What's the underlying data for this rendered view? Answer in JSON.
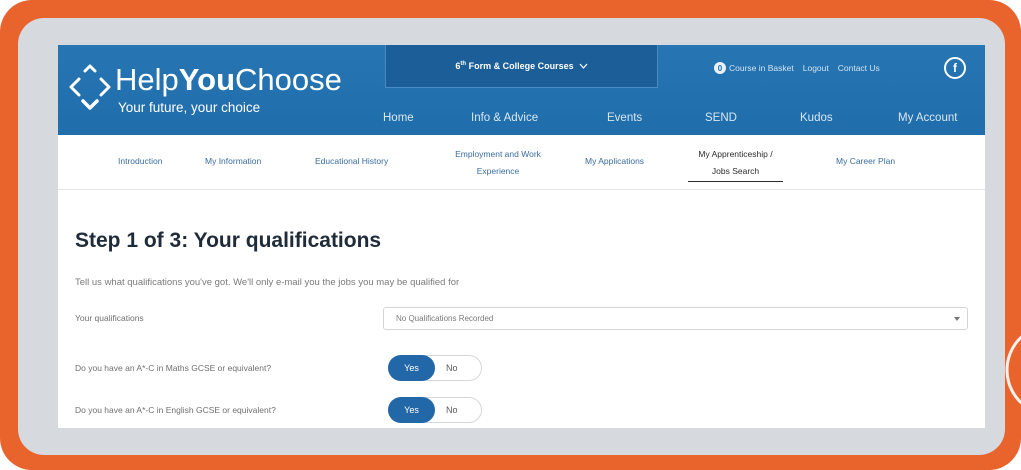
{
  "colors": {
    "frame": "#e9632d",
    "panel": "#d6dadf",
    "header": "#1f6dab",
    "link": "#3a6d9e",
    "toggle_on": "#2268a8"
  },
  "icons": {
    "logo": "help-you-choose-logo-icon",
    "courses_dropdown": "chevron-down-icon",
    "select": "caret-down-icon",
    "social": "facebook-icon"
  },
  "header": {
    "logo": {
      "help": "Help",
      "you": "You",
      "choose": "Choose",
      "tagline": "Your future, your choice"
    },
    "courses": {
      "number": "6",
      "suffix": "th",
      "label": "Form & College Courses"
    },
    "utility": {
      "basket_count": "0",
      "basket_label": "Course in Basket",
      "logout": "Logout",
      "contact": "Contact Us",
      "facebook": "f"
    },
    "nav": [
      "Home",
      "Info & Advice",
      "Events",
      "SEND",
      "Kudos",
      "My Account"
    ]
  },
  "subnav": {
    "active_index": 5,
    "items": [
      {
        "lines": [
          "Introduction"
        ]
      },
      {
        "lines": [
          "My Information"
        ]
      },
      {
        "lines": [
          "Educational History"
        ]
      },
      {
        "lines": [
          "Employment and Work",
          "Experience"
        ]
      },
      {
        "lines": [
          "My Applications"
        ]
      },
      {
        "lines": [
          "My Apprenticeship /",
          "Jobs Search"
        ]
      },
      {
        "lines": [
          "My Career Plan"
        ]
      }
    ]
  },
  "form": {
    "heading": "Step 1 of 3: Your qualifications",
    "intro": "Tell us what qualifications you've got. We'll only e-mail you the jobs you may be qualified for",
    "qualifications": {
      "label": "Your qualifications",
      "value": "No Qualifications Recorded"
    },
    "maths": {
      "label": "Do you have an A*-C in Maths GCSE or equivalent?",
      "options": [
        "Yes",
        "No"
      ],
      "selected_index": 0
    },
    "english": {
      "label": "Do you have an A*-C in English GCSE or equivalent?",
      "options": [
        "Yes",
        "No"
      ],
      "selected_index": 0
    }
  }
}
